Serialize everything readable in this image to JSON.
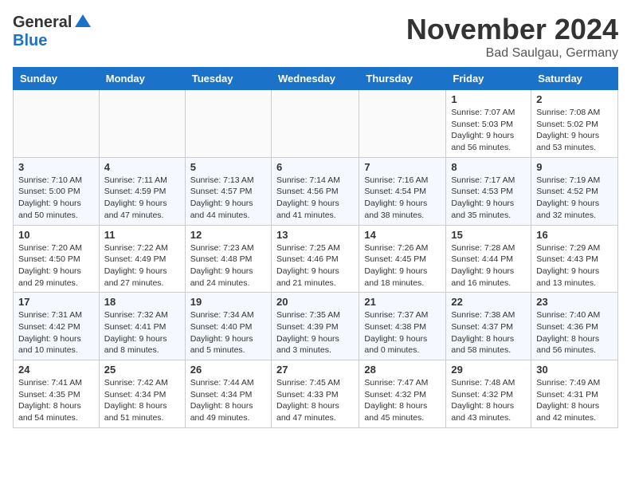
{
  "logo": {
    "general": "General",
    "blue": "Blue"
  },
  "title": "November 2024",
  "location": "Bad Saulgau, Germany",
  "weekdays": [
    "Sunday",
    "Monday",
    "Tuesday",
    "Wednesday",
    "Thursday",
    "Friday",
    "Saturday"
  ],
  "weeks": [
    [
      {
        "day": "",
        "info": ""
      },
      {
        "day": "",
        "info": ""
      },
      {
        "day": "",
        "info": ""
      },
      {
        "day": "",
        "info": ""
      },
      {
        "day": "",
        "info": ""
      },
      {
        "day": "1",
        "info": "Sunrise: 7:07 AM\nSunset: 5:03 PM\nDaylight: 9 hours and 56 minutes."
      },
      {
        "day": "2",
        "info": "Sunrise: 7:08 AM\nSunset: 5:02 PM\nDaylight: 9 hours and 53 minutes."
      }
    ],
    [
      {
        "day": "3",
        "info": "Sunrise: 7:10 AM\nSunset: 5:00 PM\nDaylight: 9 hours and 50 minutes."
      },
      {
        "day": "4",
        "info": "Sunrise: 7:11 AM\nSunset: 4:59 PM\nDaylight: 9 hours and 47 minutes."
      },
      {
        "day": "5",
        "info": "Sunrise: 7:13 AM\nSunset: 4:57 PM\nDaylight: 9 hours and 44 minutes."
      },
      {
        "day": "6",
        "info": "Sunrise: 7:14 AM\nSunset: 4:56 PM\nDaylight: 9 hours and 41 minutes."
      },
      {
        "day": "7",
        "info": "Sunrise: 7:16 AM\nSunset: 4:54 PM\nDaylight: 9 hours and 38 minutes."
      },
      {
        "day": "8",
        "info": "Sunrise: 7:17 AM\nSunset: 4:53 PM\nDaylight: 9 hours and 35 minutes."
      },
      {
        "day": "9",
        "info": "Sunrise: 7:19 AM\nSunset: 4:52 PM\nDaylight: 9 hours and 32 minutes."
      }
    ],
    [
      {
        "day": "10",
        "info": "Sunrise: 7:20 AM\nSunset: 4:50 PM\nDaylight: 9 hours and 29 minutes."
      },
      {
        "day": "11",
        "info": "Sunrise: 7:22 AM\nSunset: 4:49 PM\nDaylight: 9 hours and 27 minutes."
      },
      {
        "day": "12",
        "info": "Sunrise: 7:23 AM\nSunset: 4:48 PM\nDaylight: 9 hours and 24 minutes."
      },
      {
        "day": "13",
        "info": "Sunrise: 7:25 AM\nSunset: 4:46 PM\nDaylight: 9 hours and 21 minutes."
      },
      {
        "day": "14",
        "info": "Sunrise: 7:26 AM\nSunset: 4:45 PM\nDaylight: 9 hours and 18 minutes."
      },
      {
        "day": "15",
        "info": "Sunrise: 7:28 AM\nSunset: 4:44 PM\nDaylight: 9 hours and 16 minutes."
      },
      {
        "day": "16",
        "info": "Sunrise: 7:29 AM\nSunset: 4:43 PM\nDaylight: 9 hours and 13 minutes."
      }
    ],
    [
      {
        "day": "17",
        "info": "Sunrise: 7:31 AM\nSunset: 4:42 PM\nDaylight: 9 hours and 10 minutes."
      },
      {
        "day": "18",
        "info": "Sunrise: 7:32 AM\nSunset: 4:41 PM\nDaylight: 9 hours and 8 minutes."
      },
      {
        "day": "19",
        "info": "Sunrise: 7:34 AM\nSunset: 4:40 PM\nDaylight: 9 hours and 5 minutes."
      },
      {
        "day": "20",
        "info": "Sunrise: 7:35 AM\nSunset: 4:39 PM\nDaylight: 9 hours and 3 minutes."
      },
      {
        "day": "21",
        "info": "Sunrise: 7:37 AM\nSunset: 4:38 PM\nDaylight: 9 hours and 0 minutes."
      },
      {
        "day": "22",
        "info": "Sunrise: 7:38 AM\nSunset: 4:37 PM\nDaylight: 8 hours and 58 minutes."
      },
      {
        "day": "23",
        "info": "Sunrise: 7:40 AM\nSunset: 4:36 PM\nDaylight: 8 hours and 56 minutes."
      }
    ],
    [
      {
        "day": "24",
        "info": "Sunrise: 7:41 AM\nSunset: 4:35 PM\nDaylight: 8 hours and 54 minutes."
      },
      {
        "day": "25",
        "info": "Sunrise: 7:42 AM\nSunset: 4:34 PM\nDaylight: 8 hours and 51 minutes."
      },
      {
        "day": "26",
        "info": "Sunrise: 7:44 AM\nSunset: 4:34 PM\nDaylight: 8 hours and 49 minutes."
      },
      {
        "day": "27",
        "info": "Sunrise: 7:45 AM\nSunset: 4:33 PM\nDaylight: 8 hours and 47 minutes."
      },
      {
        "day": "28",
        "info": "Sunrise: 7:47 AM\nSunset: 4:32 PM\nDaylight: 8 hours and 45 minutes."
      },
      {
        "day": "29",
        "info": "Sunrise: 7:48 AM\nSunset: 4:32 PM\nDaylight: 8 hours and 43 minutes."
      },
      {
        "day": "30",
        "info": "Sunrise: 7:49 AM\nSunset: 4:31 PM\nDaylight: 8 hours and 42 minutes."
      }
    ]
  ]
}
